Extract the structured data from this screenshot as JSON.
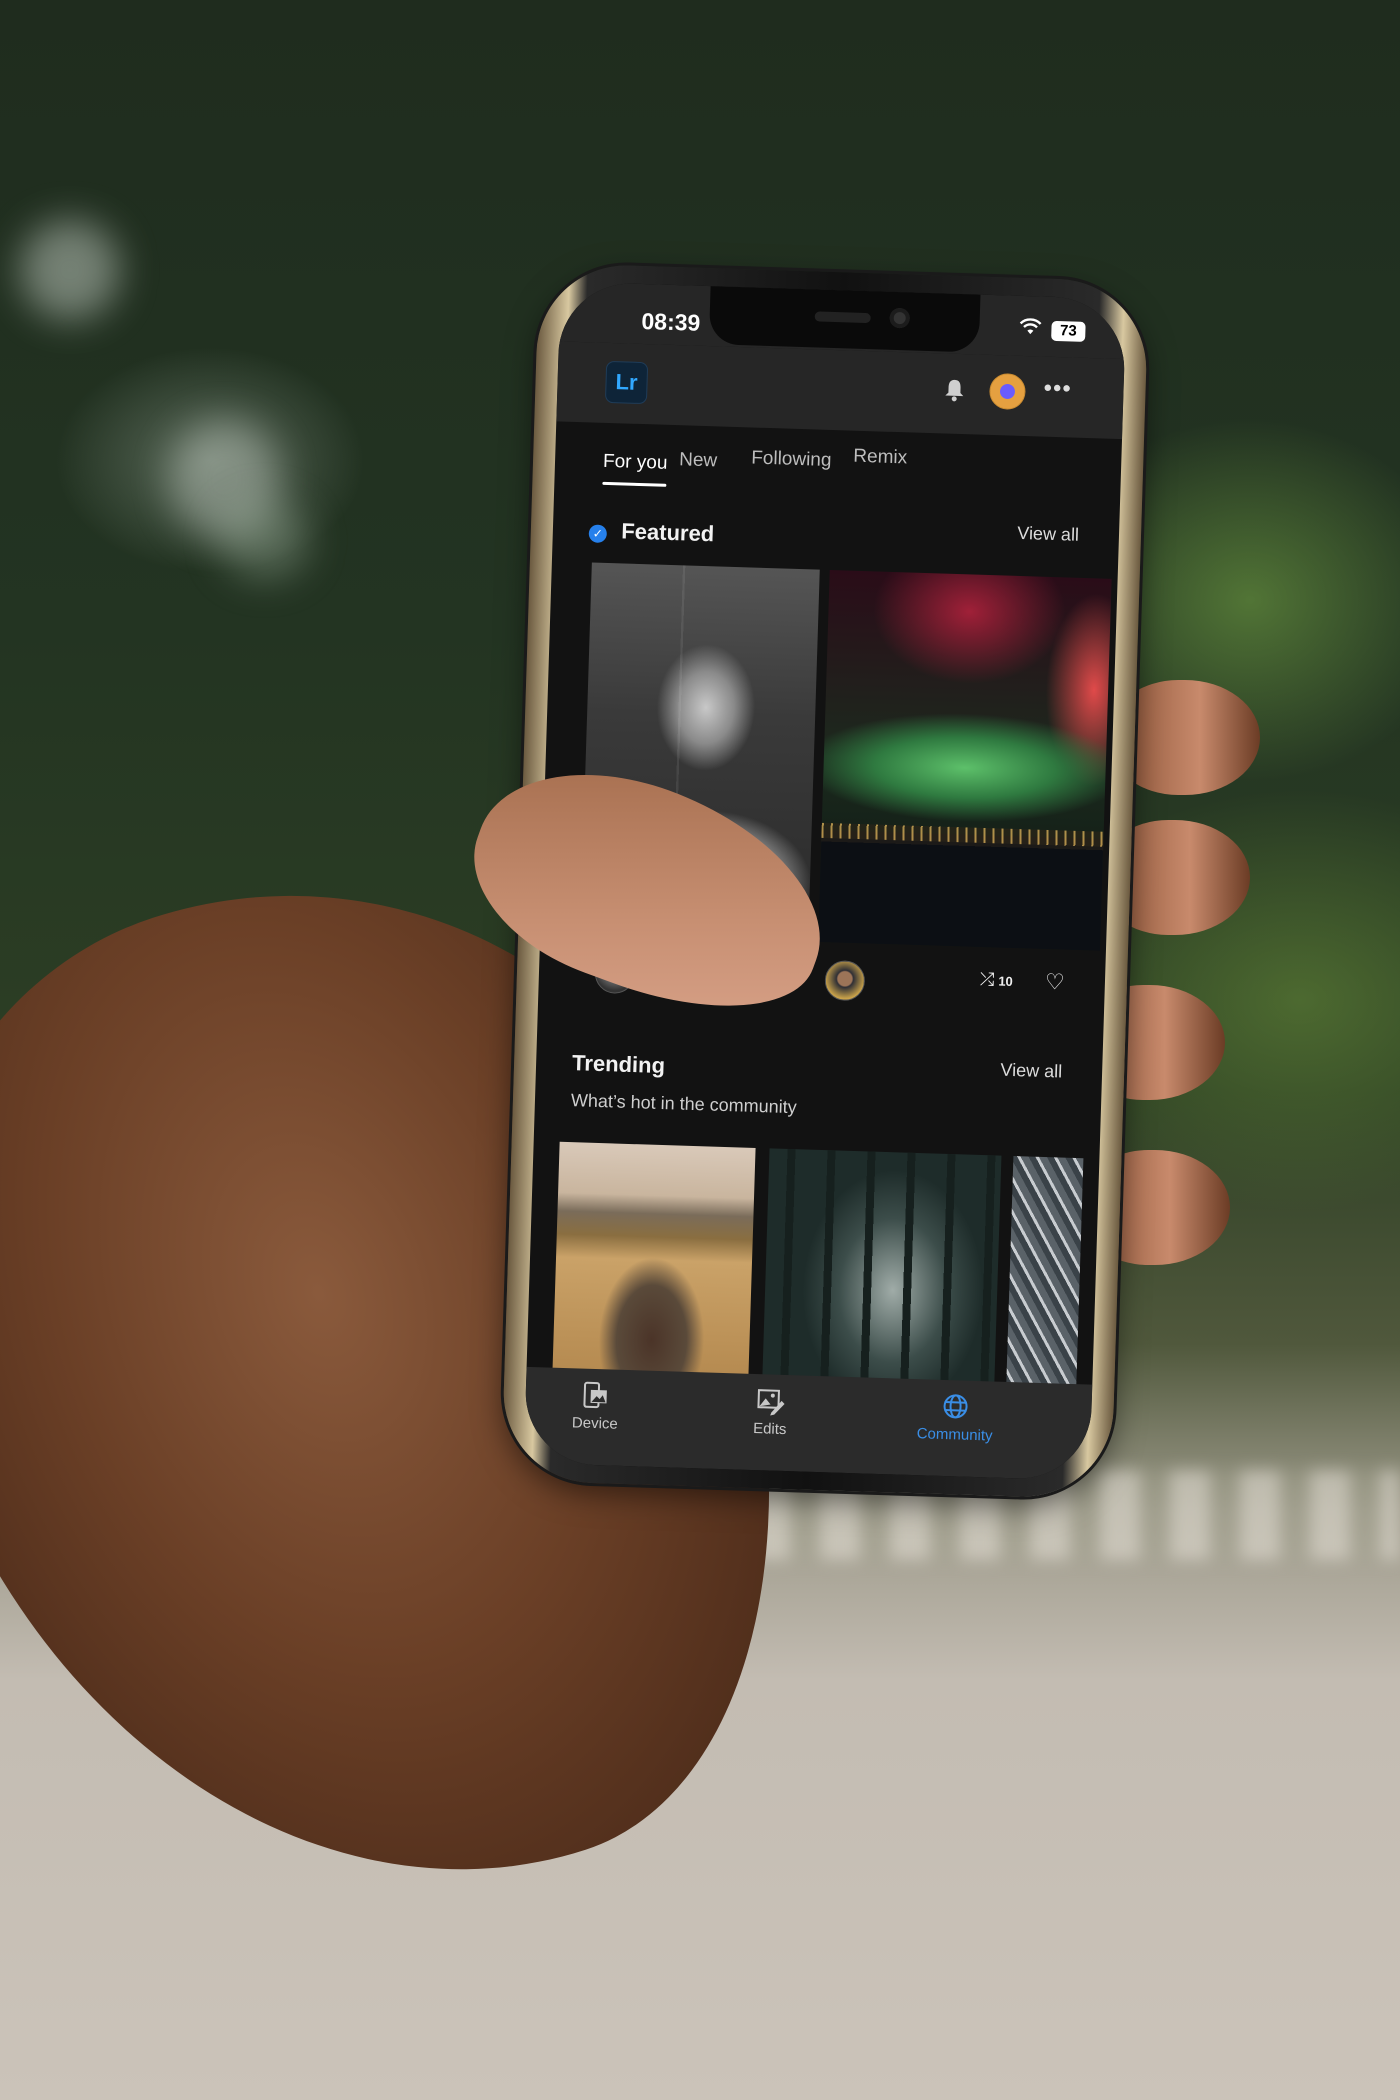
{
  "status_bar": {
    "time": "08:39",
    "battery": "73"
  },
  "app_bar": {
    "logo": "Lr",
    "icons": [
      "bell-icon",
      "avatar",
      "more-icon"
    ],
    "more_glyph": "•••"
  },
  "tabs": [
    {
      "label": "For you",
      "active": true
    },
    {
      "label": "New",
      "active": false
    },
    {
      "label": "Following",
      "active": false
    },
    {
      "label": "Remix",
      "active": false
    }
  ],
  "featured": {
    "title": "Featured",
    "view_all": "View all",
    "remix_count": "10"
  },
  "trending": {
    "title": "Trending",
    "subtitle": "What’s hot in the community",
    "view_all": "View all"
  },
  "bottom_nav": [
    {
      "label": "Device",
      "icon": "device-photos-icon",
      "active": false
    },
    {
      "label": "Edits",
      "icon": "edits-icon",
      "active": false
    },
    {
      "label": "Community",
      "icon": "globe-icon",
      "active": true
    }
  ],
  "colors": {
    "accent": "#2680eb",
    "community_active": "#3a8ee6",
    "lr_blue": "#31a8ff",
    "screen_bg": "#121212"
  }
}
